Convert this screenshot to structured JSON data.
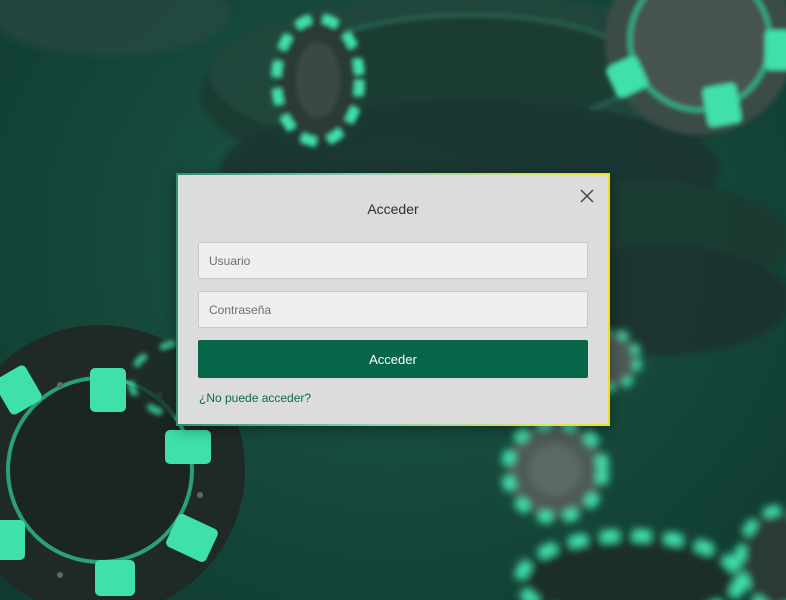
{
  "colors": {
    "background": "#15473a",
    "chip_dark": "#1e2b27",
    "chip_accent": "#3fe0ac",
    "modal_bg": "#dcdcdc",
    "primary": "#07664a",
    "link": "#0a6b4e"
  },
  "login_modal": {
    "title": "Acceder",
    "close_icon": "close-icon",
    "username": {
      "placeholder": "Usuario",
      "value": ""
    },
    "password": {
      "placeholder": "Contraseña",
      "value": ""
    },
    "submit_label": "Acceder",
    "help_link": "¿No puede acceder?"
  }
}
